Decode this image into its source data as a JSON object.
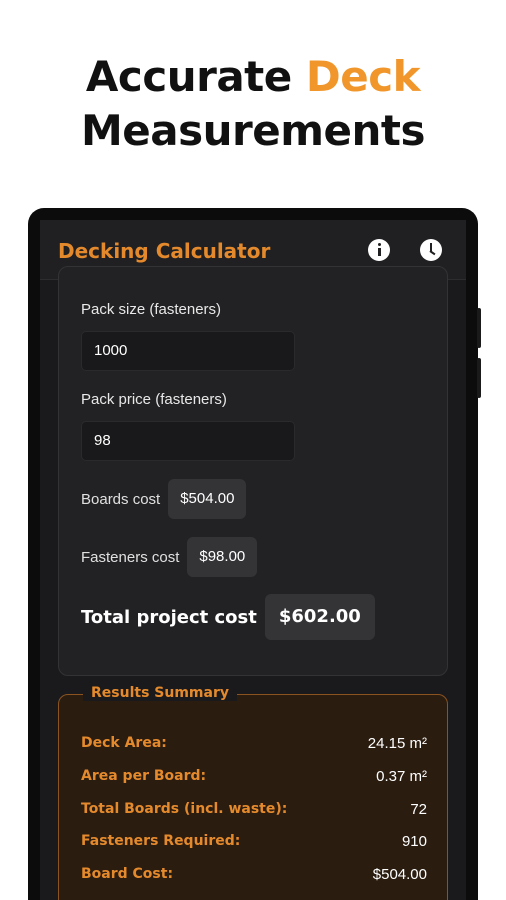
{
  "headline": {
    "line1_prefix": "Accurate",
    "line1_accent": "Deck",
    "line2": "Measurements"
  },
  "app": {
    "title": "Decking Calculator"
  },
  "icons": {
    "info": "info-icon",
    "history": "clock-icon"
  },
  "form": {
    "pack_size_label": "Pack size (fasteners)",
    "pack_size_value": "1000",
    "pack_price_label": "Pack price (fasteners)",
    "pack_price_value": "98"
  },
  "costs": {
    "boards_label": "Boards cost",
    "boards_value": "$504.00",
    "fasteners_label": "Fasteners cost",
    "fasteners_value": "$98.00",
    "total_label": "Total project cost",
    "total_value": "$602.00"
  },
  "results": {
    "title": "Results Summary",
    "rows": [
      {
        "label": "Deck Area:",
        "value": "24.15 m²"
      },
      {
        "label": "Area per Board:",
        "value": "0.37 m²"
      },
      {
        "label": "Total Boards (incl. waste):",
        "value": "72"
      },
      {
        "label": "Fasteners Required:",
        "value": "910"
      },
      {
        "label": "Board Cost:",
        "value": "$504.00"
      }
    ]
  },
  "colors": {
    "accent": "#e58a2c",
    "headline_accent": "#f0962a",
    "background": "#1a1a1c"
  }
}
